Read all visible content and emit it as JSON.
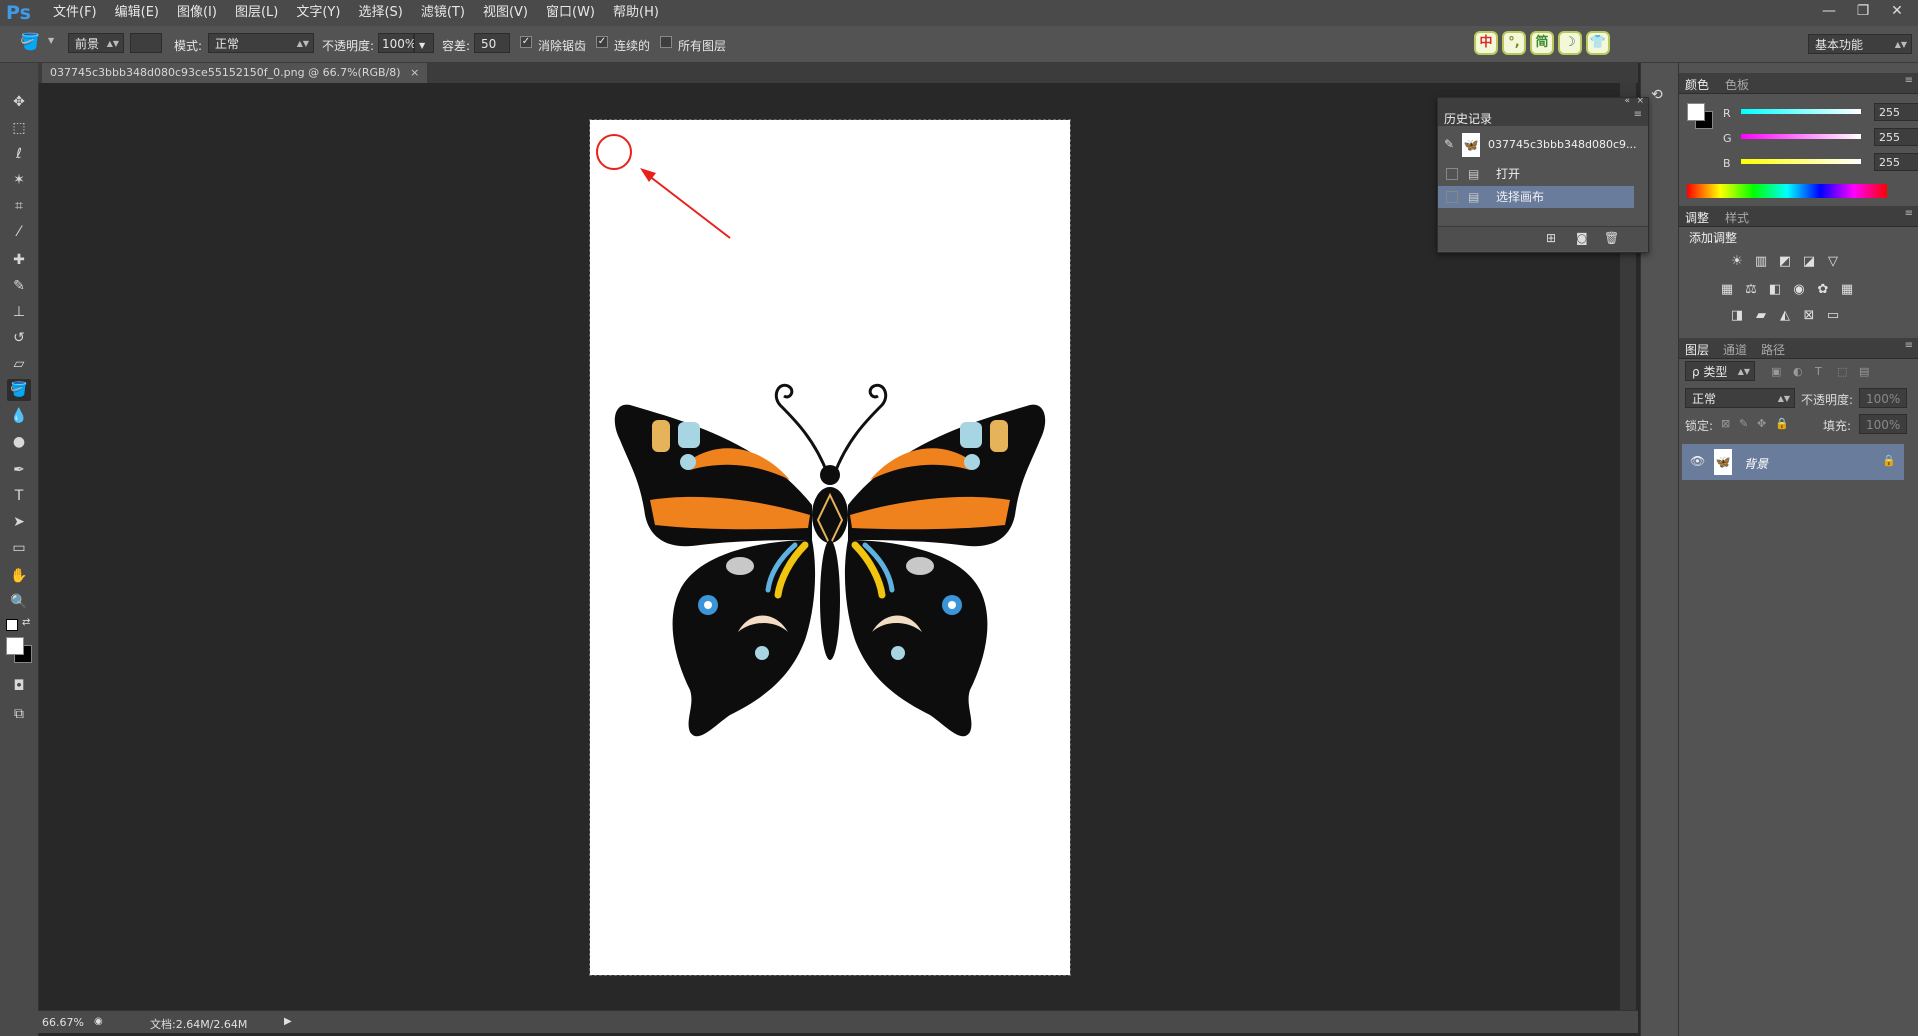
{
  "app": {
    "logo": "Ps"
  },
  "menu": {
    "items": [
      "文件(F)",
      "编辑(E)",
      "图像(I)",
      "图层(L)",
      "文字(Y)",
      "选择(S)",
      "滤镜(T)",
      "视图(V)",
      "窗口(W)",
      "帮助(H)"
    ]
  },
  "window_controls": {
    "minimize": "—",
    "restore": "❐",
    "close": "✕"
  },
  "options": {
    "fill_source": "前景",
    "mode_label": "模式:",
    "mode_value": "正常",
    "opacity_label": "不透明度:",
    "opacity_value": "100%",
    "tolerance_label": "容差:",
    "tolerance_value": "50",
    "antialias_label": "消除锯齿",
    "contiguous_label": "连续的",
    "all_layers_label": "所有图层",
    "ime_buttons": [
      "中",
      "°,",
      "简",
      "☽",
      "👕"
    ],
    "workspace": "基本功能"
  },
  "document": {
    "tab_title": "037745c3bbb348d080c93ce55152150f_0.png @ 66.7%(RGB/8)",
    "tab_close": "×"
  },
  "status": {
    "zoom": "66.67%",
    "doc_info": "文档:2.64M/2.64M"
  },
  "history_panel": {
    "title": "历史记录",
    "snapshot": "037745c3bbb348d080c9...",
    "steps": [
      "打开",
      "选择画布"
    ],
    "selected_index": 1
  },
  "color_panel": {
    "tabs": [
      "颜色",
      "色板"
    ],
    "channels": [
      {
        "label": "R",
        "value": "255"
      },
      {
        "label": "G",
        "value": "255"
      },
      {
        "label": "B",
        "value": "255"
      }
    ]
  },
  "adjust_panel": {
    "tabs": [
      "调整",
      "样式"
    ],
    "title": "添加调整"
  },
  "layers_panel": {
    "tabs": [
      "图层",
      "通道",
      "路径"
    ],
    "filter": "ρ 类型",
    "blend": "正常",
    "opacity_label": "不透明度:",
    "opacity_value": "100%",
    "lock_label": "锁定:",
    "fill_label": "填充:",
    "fill_value": "100%",
    "layer_name": "背景"
  },
  "colors": {
    "accent_blue": "#3d9be9",
    "selected_row": "#6a7c9b",
    "annotation_red": "#e8221b",
    "butterfly_orange": "#f0821e"
  }
}
